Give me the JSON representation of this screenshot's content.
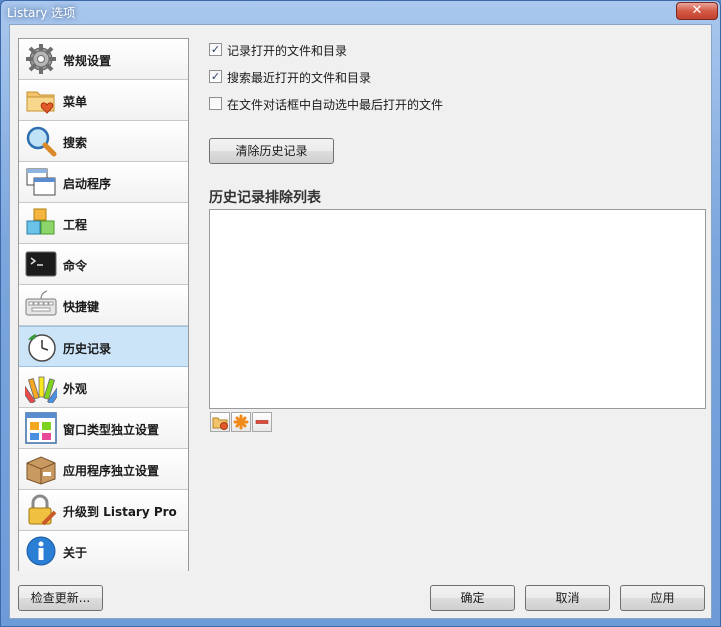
{
  "window": {
    "title": "Listary 选项",
    "close_glyph": "✕"
  },
  "sidebar": {
    "items": [
      {
        "label": "常规设置",
        "icon": "gear-icon"
      },
      {
        "label": "菜单",
        "icon": "folder-heart-icon"
      },
      {
        "label": "搜索",
        "icon": "magnifier-icon"
      },
      {
        "label": "启动程序",
        "icon": "windows-stack-icon"
      },
      {
        "label": "工程",
        "icon": "cubes-icon"
      },
      {
        "label": "命令",
        "icon": "terminal-icon"
      },
      {
        "label": "快捷键",
        "icon": "keyboard-icon"
      },
      {
        "label": "历史记录",
        "icon": "clock-history-icon",
        "selected": true
      },
      {
        "label": "外观",
        "icon": "color-palette-icon"
      },
      {
        "label": "窗口类型独立设置",
        "icon": "window-grid-icon"
      },
      {
        "label": "应用程序独立设置",
        "icon": "package-box-icon"
      },
      {
        "label": "升级到 Listary Pro",
        "icon": "lock-pen-icon"
      },
      {
        "label": "关于",
        "icon": "info-icon"
      }
    ]
  },
  "history": {
    "options": [
      {
        "label": "记录打开的文件和目录",
        "checked": true
      },
      {
        "label": "搜索最近打开的文件和目录",
        "checked": true
      },
      {
        "label": "在文件对话框中自动选中最后打开的文件",
        "checked": false
      }
    ],
    "check_glyph": "✓",
    "clear_button": "清除历史记录",
    "exclusion_title": "历史记录排除列表",
    "tools": [
      "add-folder-icon",
      "add-wildcard-icon",
      "remove-icon"
    ]
  },
  "footer": {
    "check_updates": "检查更新...",
    "ok": "确定",
    "cancel": "取消",
    "apply": "应用"
  }
}
